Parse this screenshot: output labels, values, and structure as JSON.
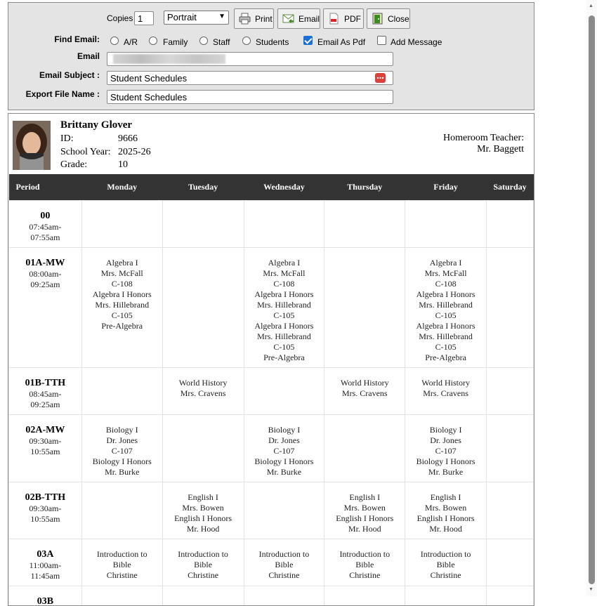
{
  "controls": {
    "copies_label": "Copies",
    "copies_value": "1",
    "orientation": "Portrait",
    "buttons": {
      "print": "Print",
      "email": "Email",
      "pdf": "PDF",
      "close": "Close"
    },
    "find_email_label": "Find Email:",
    "find_options": [
      "A/R",
      "Family",
      "Staff",
      "Students"
    ],
    "email_as_pdf": {
      "label": "Email As Pdf",
      "checked": true
    },
    "add_message": {
      "label": "Add Message",
      "checked": false
    },
    "email_label": "Email",
    "email_subject_label": "Email Subject :",
    "email_subject_value": "Student Schedules",
    "export_file_label": "Export File Name :",
    "export_file_value": "Student Schedules"
  },
  "student": {
    "name": "Brittany Glover",
    "id_label": "ID:",
    "id": "9666",
    "year_label": "School Year:",
    "year": "2025-26",
    "grade_label": "Grade:",
    "grade": "10",
    "homeroom_label": "Homeroom Teacher:",
    "homeroom_teacher": "Mr. Baggett"
  },
  "schedule": {
    "headers": [
      "Period",
      "Monday",
      "Tuesday",
      "Wednesday",
      "Thursday",
      "Friday",
      "Saturday"
    ],
    "rows": [
      {
        "period": "00",
        "time": [
          "07:45am-",
          "07:55am"
        ],
        "days": [
          [],
          [],
          [],
          [],
          [],
          []
        ]
      },
      {
        "period": "01A-MW",
        "time": [
          "08:00am-",
          "09:25am"
        ],
        "days": [
          [
            "Algebra I",
            "Mrs. McFall",
            "C-108",
            "Algebra I Honors",
            "Mrs. Hillebrand",
            "C-105",
            "Pre-Algebra"
          ],
          [],
          [
            "Algebra I",
            "Mrs. McFall",
            "C-108",
            "Algebra I Honors",
            "Mrs. Hillebrand",
            "C-105",
            "Algebra I Honors",
            "Mrs. Hillebrand",
            "C-105",
            "Pre-Algebra"
          ],
          [],
          [
            "Algebra I",
            "Mrs. McFall",
            "C-108",
            "Algebra I Honors",
            "Mrs. Hillebrand",
            "C-105",
            "Algebra I Honors",
            "Mrs. Hillebrand",
            "C-105",
            "Pre-Algebra"
          ],
          []
        ]
      },
      {
        "period": "01B-TTH",
        "time": [
          "08:45am-",
          "09:25am"
        ],
        "days": [
          [],
          [
            "World History",
            "Mrs. Cravens"
          ],
          [],
          [
            "World History",
            "Mrs. Cravens"
          ],
          [
            "World History",
            "Mrs. Cravens"
          ],
          []
        ]
      },
      {
        "period": "02A-MW",
        "time": [
          "09:30am-",
          "10:55am"
        ],
        "days": [
          [
            "Biology I",
            "Dr. Jones",
            "C-107",
            "Biology I Honors",
            "Mr. Burke"
          ],
          [],
          [
            "Biology I",
            "Dr. Jones",
            "C-107",
            "Biology I Honors",
            "Mr. Burke"
          ],
          [],
          [
            "Biology I",
            "Dr. Jones",
            "C-107",
            "Biology I Honors",
            "Mr. Burke"
          ],
          []
        ]
      },
      {
        "period": "02B-TTH",
        "time": [
          "09:30am-",
          "10:55am"
        ],
        "days": [
          [],
          [
            "English I",
            "Mrs. Bowen",
            "English I Honors",
            "Mr. Hood"
          ],
          [],
          [
            "English I",
            "Mrs. Bowen",
            "English I Honors",
            "Mr. Hood"
          ],
          [
            "English I",
            "Mrs. Bowen",
            "English I Honors",
            "Mr. Hood"
          ],
          []
        ]
      },
      {
        "period": "03A",
        "time": [
          "11:00am-",
          "11:45am"
        ],
        "days": [
          [
            "Introduction to",
            "Bible",
            "Christine"
          ],
          [
            "Introduction to",
            "Bible",
            "Christine"
          ],
          [
            "Introduction to",
            "Bible",
            "Christine"
          ],
          [
            "Introduction to",
            "Bible",
            "Christine"
          ],
          [
            "Introduction to",
            "Bible",
            "Christine"
          ],
          []
        ]
      },
      {
        "period": "03B",
        "time": [],
        "days": [
          [],
          [],
          [],
          [],
          [],
          []
        ]
      }
    ]
  }
}
